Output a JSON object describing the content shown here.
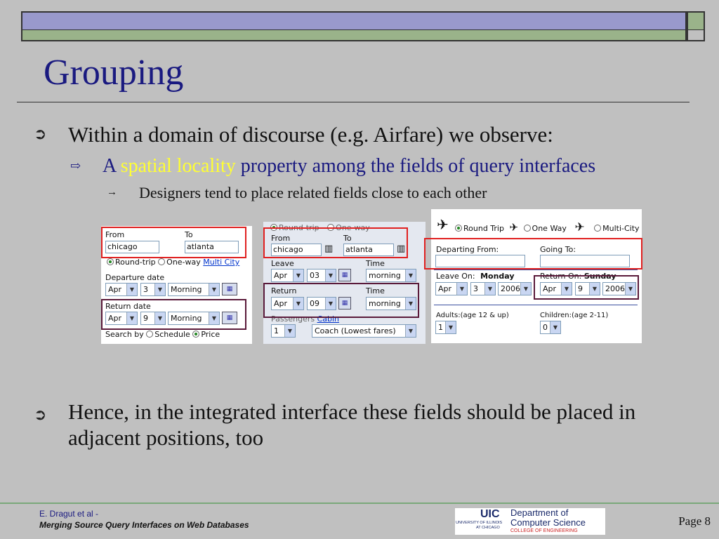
{
  "slide": {
    "title": "Grouping",
    "bullet1": "Within a domain of discourse (e.g. Airfare) we observe:",
    "sub1_pre": "A ",
    "sub1_highlight": "spatial locality",
    "sub1_post": " property among the fields of query interfaces",
    "subsub1": "Designers tend to place related fields close to each other",
    "bullet2": "Hence, in the integrated interface these fields should be placed in adjacent positions, too",
    "bullet_glyph": "➲",
    "sub_glyph": "⇨",
    "subsub_glyph": "→"
  },
  "form1": {
    "from_label": "From",
    "to_label": "To",
    "from_value": "chicago",
    "to_value": "atlanta",
    "roundtrip": "Round-trip",
    "oneway": "One-way",
    "multicity": "Multi City",
    "departure_label": "Departure date",
    "dep_month": "Apr",
    "dep_day": "3",
    "dep_time": "Morning",
    "return_label": "Return date",
    "ret_month": "Apr",
    "ret_day": "9",
    "ret_time": "Morning",
    "search_by": "Search by",
    "schedule": "Schedule",
    "price": "Price"
  },
  "form2": {
    "roundtrip": "Round-trip",
    "oneway": "One-way",
    "from_label": "From",
    "to_label": "To",
    "from_value": "chicago",
    "to_value": "atlanta",
    "leave_label": "Leave",
    "time_label": "Time",
    "leave_month": "Apr",
    "leave_day": "03",
    "leave_time": "morning",
    "return_label": "Return",
    "return_time_label": "Time",
    "ret_month": "Apr",
    "ret_day": "09",
    "ret_time": "morning",
    "passengers_label": "Passengers",
    "cabin_link": "Cabin",
    "passengers": "1",
    "cabin": "Coach (Lowest fares)"
  },
  "form3": {
    "roundtrip": "Round Trip",
    "oneway": "One Way",
    "multicity": "Multi-City",
    "departing_label": "Departing From:",
    "going_label": "Going To:",
    "leave_on": "Leave On:",
    "leave_dayname": "Monday",
    "return_on": "Return On:",
    "return_dayname": "Sunday",
    "leave_month": "Apr",
    "leave_day": "3",
    "leave_year": "2006",
    "ret_month": "Apr",
    "ret_day": "9",
    "ret_year": "2006",
    "adults_label": "Adults:(age 12 & up)",
    "children_label": "Children:(age 2-11)",
    "adults": "1",
    "children": "0"
  },
  "footer": {
    "author": "E. Dragut et al -",
    "paper": "Merging Source Query Interfaces on Web Databases",
    "uic": "UIC",
    "uic_sub1": "UNIVERSITY OF ILLINOIS",
    "uic_sub2": "AT CHICAGO",
    "dept1": "Department of",
    "dept2": "Computer Science",
    "college": "COLLEGE OF ENGINEERING",
    "page": "Page 8"
  },
  "colors": {
    "title": "#1a1a80",
    "highlight": "#ffff33",
    "red_box": "#e02020",
    "purple_box": "#5a1a3a",
    "background": "#c0c0c0"
  },
  "icons": [
    "calendar-icon",
    "plane-icon",
    "map-icon",
    "dropdown-arrow-icon"
  ]
}
